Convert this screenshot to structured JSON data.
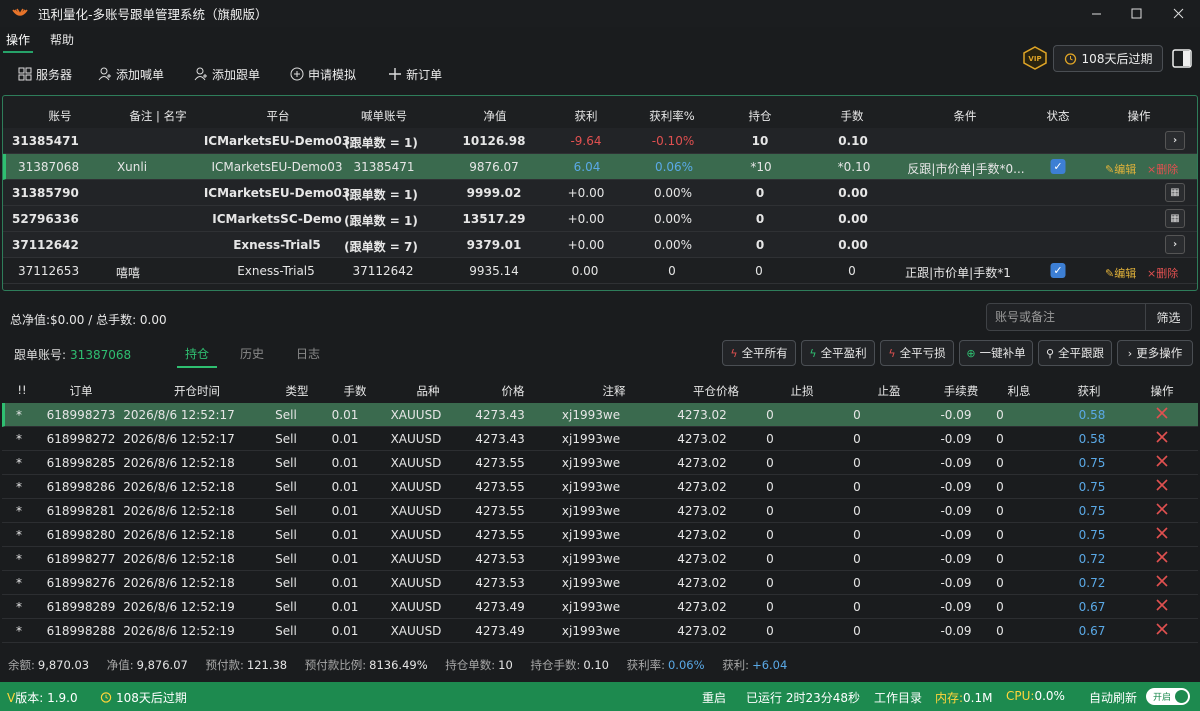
{
  "app": {
    "title": "迅利量化-多账号跟单管理系统（旗舰版）"
  },
  "menu": [
    "操作",
    "帮助"
  ],
  "toolbar": {
    "servers": "服务器",
    "add_shout": "添加喊单",
    "add_follow": "添加跟单",
    "apply_demo": "申请模拟",
    "new_order": "新订单",
    "expire": "108天后过期"
  },
  "accounts": {
    "headers": [
      "账号",
      "备注 | 名字",
      "平台",
      "喊单账号",
      "净值",
      "获利",
      "获利率%",
      "持仓",
      "手数",
      "条件",
      "状态",
      "操作"
    ],
    "edit_label": "编辑",
    "delete_label": "删除",
    "rows": [
      {
        "account": "31385471",
        "note": "",
        "platform": "ICMarketsEU-Demo03",
        "shout": "(跟单数 = 1)",
        "equity": "10126.98",
        "profit": "-9.64",
        "rate": "-0.10%",
        "positions": "10",
        "lots": "0.10",
        "condition": ""
      },
      {
        "account": "31387068",
        "note": "Xunli",
        "platform": "ICMarketsEU-Demo03",
        "shout": "31385471",
        "equity": "9876.07",
        "profit": "6.04",
        "rate": "0.06%",
        "positions": "*10",
        "lots": "*0.10",
        "condition": "反跟|市价单|手数*0..."
      },
      {
        "account": "31385790",
        "note": "",
        "platform": "ICMarketsEU-Demo03",
        "shout": "(跟单数 = 1)",
        "equity": "9999.02",
        "profit": "+0.00",
        "rate": "0.00%",
        "positions": "0",
        "lots": "0.00",
        "condition": ""
      },
      {
        "account": "52796336",
        "note": "",
        "platform": "ICMarketsSC-Demo",
        "shout": "(跟单数 = 1)",
        "equity": "13517.29",
        "profit": "+0.00",
        "rate": "0.00%",
        "positions": "0",
        "lots": "0.00",
        "condition": ""
      },
      {
        "account": "37112642",
        "note": "",
        "platform": "Exness-Trial5",
        "shout": "(跟单数 = 7)",
        "equity": "9379.01",
        "profit": "+0.00",
        "rate": "0.00%",
        "positions": "0",
        "lots": "0.00",
        "condition": ""
      },
      {
        "account": "37112653",
        "note": "嘻嘻",
        "platform": "Exness-Trial5",
        "shout": "37112642",
        "equity": "9935.14",
        "profit": "0.00",
        "rate": "0",
        "positions": "0",
        "lots": "0",
        "condition": "正跟|市价单|手数*1"
      }
    ]
  },
  "summary": {
    "text": "总净值:$0.00 / 总手数: 0.00",
    "search_placeholder": "账号或备注",
    "filter": "筛选"
  },
  "detail": {
    "follow_label": "跟单账号:",
    "follow_account": "31387068",
    "tabs": [
      "持仓",
      "历史",
      "日志"
    ],
    "actions": [
      "全平所有",
      "全平盈利",
      "全平亏损",
      "一键补单",
      "全平跟跟",
      "更多操作"
    ]
  },
  "orders": {
    "headers": [
      "!!",
      "订单",
      "开仓时间",
      "类型",
      "手数",
      "品种",
      "价格",
      "注释",
      "平仓价格",
      "止损",
      "止盈",
      "手续费",
      "利息",
      "获利",
      "操作"
    ],
    "rows": [
      {
        "flag": "*",
        "id": "618998273",
        "time": "2026/8/6 12:52:17",
        "type": "Sell",
        "lots": "0.01",
        "symbol": "XAUUSD",
        "price": "4273.43",
        "comment": "xj1993we",
        "close": "4273.02",
        "sl": "0",
        "tp": "0",
        "fee": "-0.09",
        "swap": "0",
        "profit": "0.58"
      },
      {
        "flag": "*",
        "id": "618998272",
        "time": "2026/8/6 12:52:17",
        "type": "Sell",
        "lots": "0.01",
        "symbol": "XAUUSD",
        "price": "4273.43",
        "comment": "xj1993we",
        "close": "4273.02",
        "sl": "0",
        "tp": "0",
        "fee": "-0.09",
        "swap": "0",
        "profit": "0.58"
      },
      {
        "flag": "*",
        "id": "618998285",
        "time": "2026/8/6 12:52:18",
        "type": "Sell",
        "lots": "0.01",
        "symbol": "XAUUSD",
        "price": "4273.55",
        "comment": "xj1993we",
        "close": "4273.02",
        "sl": "0",
        "tp": "0",
        "fee": "-0.09",
        "swap": "0",
        "profit": "0.75"
      },
      {
        "flag": "*",
        "id": "618998286",
        "time": "2026/8/6 12:52:18",
        "type": "Sell",
        "lots": "0.01",
        "symbol": "XAUUSD",
        "price": "4273.55",
        "comment": "xj1993we",
        "close": "4273.02",
        "sl": "0",
        "tp": "0",
        "fee": "-0.09",
        "swap": "0",
        "profit": "0.75"
      },
      {
        "flag": "*",
        "id": "618998281",
        "time": "2026/8/6 12:52:18",
        "type": "Sell",
        "lots": "0.01",
        "symbol": "XAUUSD",
        "price": "4273.55",
        "comment": "xj1993we",
        "close": "4273.02",
        "sl": "0",
        "tp": "0",
        "fee": "-0.09",
        "swap": "0",
        "profit": "0.75"
      },
      {
        "flag": "*",
        "id": "618998280",
        "time": "2026/8/6 12:52:18",
        "type": "Sell",
        "lots": "0.01",
        "symbol": "XAUUSD",
        "price": "4273.55",
        "comment": "xj1993we",
        "close": "4273.02",
        "sl": "0",
        "tp": "0",
        "fee": "-0.09",
        "swap": "0",
        "profit": "0.75"
      },
      {
        "flag": "*",
        "id": "618998277",
        "time": "2026/8/6 12:52:18",
        "type": "Sell",
        "lots": "0.01",
        "symbol": "XAUUSD",
        "price": "4273.53",
        "comment": "xj1993we",
        "close": "4273.02",
        "sl": "0",
        "tp": "0",
        "fee": "-0.09",
        "swap": "0",
        "profit": "0.72"
      },
      {
        "flag": "*",
        "id": "618998276",
        "time": "2026/8/6 12:52:18",
        "type": "Sell",
        "lots": "0.01",
        "symbol": "XAUUSD",
        "price": "4273.53",
        "comment": "xj1993we",
        "close": "4273.02",
        "sl": "0",
        "tp": "0",
        "fee": "-0.09",
        "swap": "0",
        "profit": "0.72"
      },
      {
        "flag": "*",
        "id": "618998289",
        "time": "2026/8/6 12:52:19",
        "type": "Sell",
        "lots": "0.01",
        "symbol": "XAUUSD",
        "price": "4273.49",
        "comment": "xj1993we",
        "close": "4273.02",
        "sl": "0",
        "tp": "0",
        "fee": "-0.09",
        "swap": "0",
        "profit": "0.67"
      },
      {
        "flag": "*",
        "id": "618998288",
        "time": "2026/8/6 12:52:19",
        "type": "Sell",
        "lots": "0.01",
        "symbol": "XAUUSD",
        "price": "4273.49",
        "comment": "xj1993we",
        "close": "4273.02",
        "sl": "0",
        "tp": "0",
        "fee": "-0.09",
        "swap": "0",
        "profit": "0.67"
      }
    ]
  },
  "stats": {
    "balance_label": "余额:",
    "balance": "9,870.03",
    "equity_label": "净值:",
    "equity": "9,876.07",
    "prepay_label": "预付款:",
    "prepay": "121.38",
    "prepay_ratio_label": "预付款比例:",
    "prepay_ratio": "8136.49%",
    "pos_count_label": "持仓单数:",
    "pos_count": "10",
    "pos_lots_label": "持仓手数:",
    "pos_lots": "0.10",
    "rate_label": "获利率:",
    "rate": "0.06%",
    "profit_label": "获利:",
    "profit": "+6.04"
  },
  "status": {
    "version_prefix": "V",
    "version": "版本: 1.9.0",
    "expire": "108天后过期",
    "restart": "重启",
    "running": "已运行 2时23分48秒",
    "workdir": "工作目录",
    "mem_label": "内存:",
    "mem": "0.1M",
    "cpu_label": "CPU:",
    "cpu": "0.0%",
    "auto_refresh": "自动刷新",
    "toggle": "开启"
  },
  "colors": {
    "accent": "#2fbf71",
    "status_bar": "#1d8a4f",
    "loss": "#e05050",
    "gain": "#5aa9e6"
  }
}
